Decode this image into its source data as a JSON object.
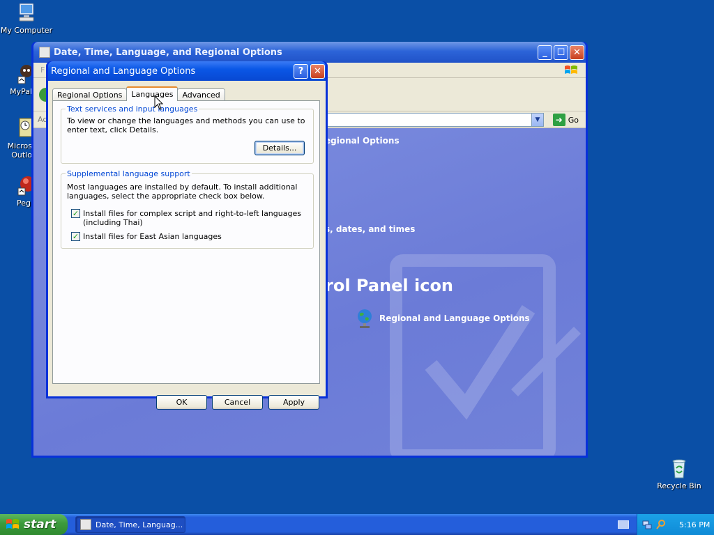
{
  "desktop": {
    "icons": [
      {
        "label": "My Computer",
        "icon": "computer-icon"
      },
      {
        "label": "MyPal",
        "icon": "mypal-icon"
      },
      {
        "label": "Micros\nOutlo",
        "icon": "outlook-icon"
      },
      {
        "label": "Peg",
        "icon": "pegasus-icon"
      }
    ],
    "recycle_bin": {
      "label": "Recycle Bin",
      "icon": "recycle-bin-icon"
    }
  },
  "control_panel_window": {
    "title": "Date, Time, Language, and Regional Options",
    "menubar_partial": "F",
    "address_label_partial": "Ac",
    "go_label": "Go",
    "content": {
      "heading_partial": "egional Options",
      "task_partial": "s, dates, and times",
      "pick_icon_partial": "rol Panel icon",
      "link_label": "Regional and Language Options"
    }
  },
  "dialog": {
    "title": "Regional and Language Options",
    "help_button": "?",
    "close_button": "✕",
    "tabs": [
      "Regional Options",
      "Languages",
      "Advanced"
    ],
    "active_tab": "Languages",
    "text_services": {
      "legend": "Text services and input languages",
      "description": "To view or change the languages and methods you can use to enter text, click Details.",
      "details_button": "Details..."
    },
    "supplemental": {
      "legend": "Supplemental language support",
      "description": "Most languages are installed by default. To install additional languages, select the appropriate check box below.",
      "checkbox_complex": {
        "label": "Install files for complex script and right-to-left languages (including Thai)",
        "checked": true
      },
      "checkbox_east_asian": {
        "label": "Install files for East Asian languages",
        "checked": true
      }
    },
    "buttons": {
      "ok": "OK",
      "cancel": "Cancel",
      "apply": "Apply"
    }
  },
  "taskbar": {
    "start_label": "start",
    "task_items": [
      {
        "label": "Date, Time, Languag..."
      }
    ],
    "clock": "5:16 PM"
  },
  "colors": {
    "desktop": "#0a4fa6",
    "titlebar": "#0a57e6",
    "group_legend": "#0046d5",
    "taskbar": "#245edb",
    "start_button": "#3c9a3c",
    "cp_content": "#7e8fe0"
  }
}
